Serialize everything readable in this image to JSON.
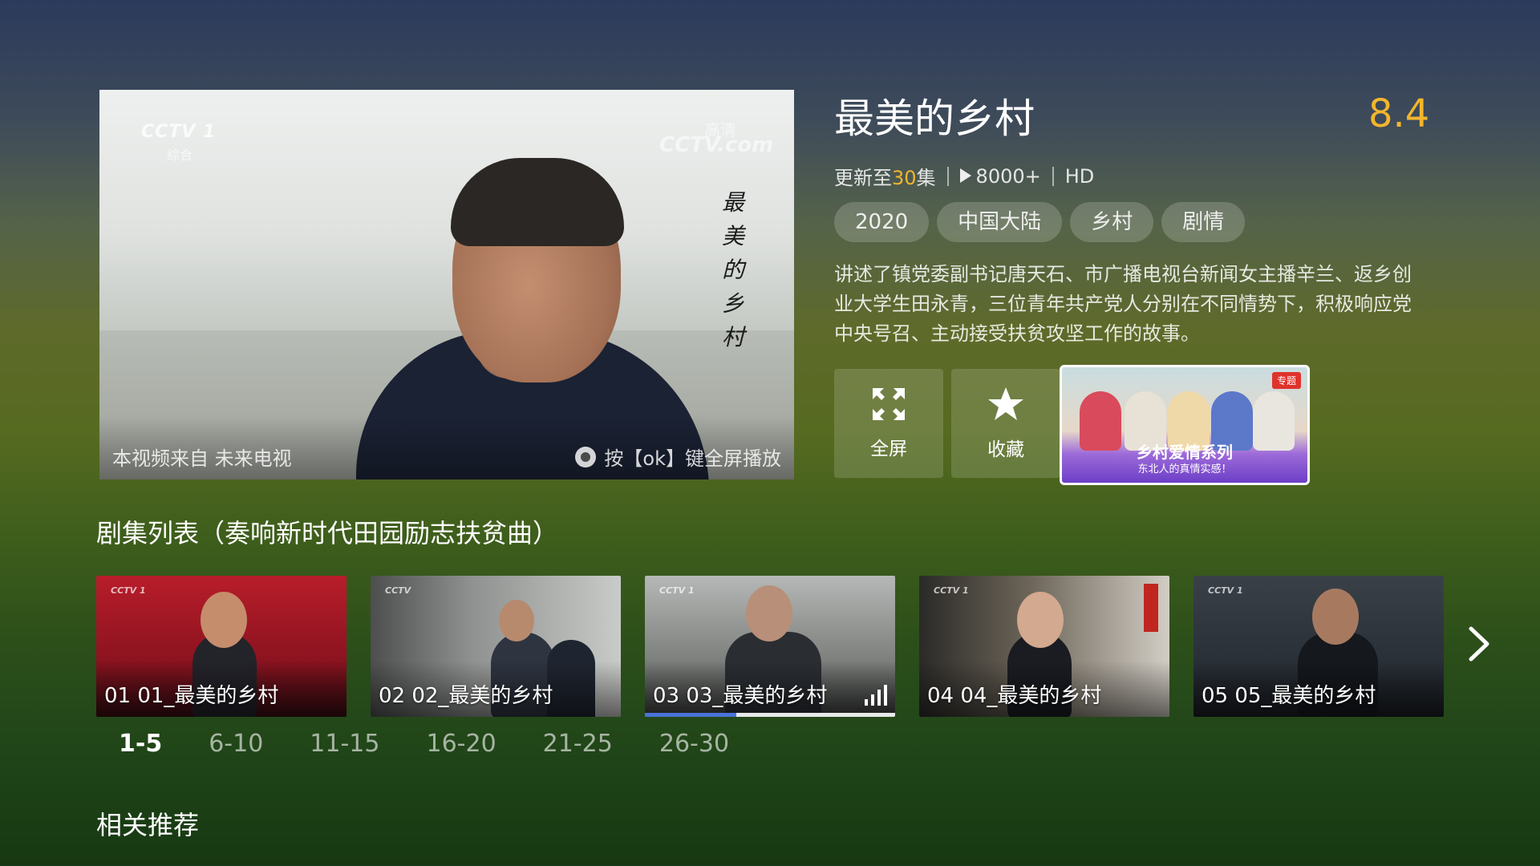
{
  "player": {
    "channel_logo": "CCTV 1",
    "channel_sub": "综合",
    "site_logo": "CCTV.com",
    "hd_mark": "高清",
    "video_title": "最美的乡村",
    "source_text": "本视频来自 未来电视",
    "hint_text": "按【ok】键全屏播放"
  },
  "show": {
    "title": "最美的乡村",
    "rating": "8.4",
    "update_prefix": "更新至",
    "update_count": "30",
    "update_suffix": "集",
    "views": "8000+",
    "quality": "HD",
    "tags": [
      "2020",
      "中国大陆",
      "乡村",
      "剧情"
    ],
    "description": "讲述了镇党委副书记唐天石、市广播电视台新闻女主播辛兰、返乡创业大学生田永青，三位青年共产党人分别在不同情势下，积极响应党中央号召、主动接受扶贫攻坚工作的故事。"
  },
  "actions": {
    "fullscreen_label": "全屏",
    "favorite_label": "收藏"
  },
  "promo": {
    "badge": "专题",
    "title": "乡村爱情系列",
    "subtitle": "东北人的真情实感！"
  },
  "episodes_section": {
    "title": "剧集列表（奏响新时代田园励志扶贫曲）",
    "episodes": [
      {
        "label": "01 01_最美的乡村",
        "logo": "CCTV 1"
      },
      {
        "label": "02 02_最美的乡村",
        "logo": "CCTV"
      },
      {
        "label": "03 03_最美的乡村",
        "logo": "CCTV 1",
        "playing": true,
        "progress": 0.37
      },
      {
        "label": "04 04_最美的乡村",
        "logo": "CCTV 1"
      },
      {
        "label": "05 05_最美的乡村",
        "logo": "CCTV 1"
      }
    ],
    "ranges": [
      "1-5",
      "6-10",
      "11-15",
      "16-20",
      "21-25",
      "26-30"
    ],
    "active_range": "1-5"
  },
  "related": {
    "title": "相关推荐"
  },
  "colors": {
    "accent": "#f3b52c",
    "progress": "#4a73d8"
  }
}
